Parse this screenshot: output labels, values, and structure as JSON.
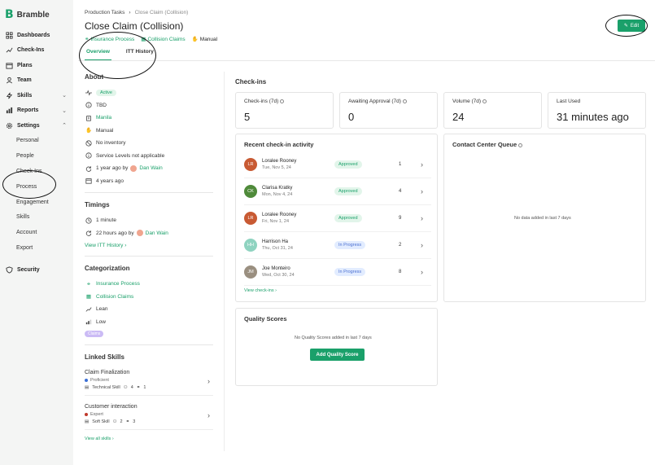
{
  "app": {
    "name": "Bramble"
  },
  "sidebar": {
    "items": [
      {
        "label": "Dashboards",
        "icon": "dashboard-icon"
      },
      {
        "label": "Check-Ins",
        "icon": "trend-icon"
      },
      {
        "label": "Plans",
        "icon": "calendar-icon"
      },
      {
        "label": "Team",
        "icon": "team-icon"
      },
      {
        "label": "Skills",
        "icon": "bolt-icon"
      },
      {
        "label": "Reports",
        "icon": "bar-chart-icon"
      },
      {
        "label": "Settings",
        "icon": "gear-icon"
      }
    ],
    "settings_children": [
      "Personal",
      "People",
      "Check-Ins",
      "Process",
      "Engagement",
      "Skills",
      "Account",
      "Export"
    ],
    "security": "Security"
  },
  "breadcrumb": {
    "parent": "Production Tasks",
    "current": "Close Claim (Collision)"
  },
  "page": {
    "title": "Close Claim (Collision)",
    "meta": {
      "process": "Insurance Process",
      "claims": "Collision Claims",
      "mode": "Manual"
    },
    "tabs": [
      "Overview",
      "ITT History"
    ],
    "edit_label": "Edit"
  },
  "about": {
    "title": "About",
    "status": "Active",
    "owner": "TBD",
    "location": "Manila",
    "mode": "Manual",
    "inventory": "No inventory",
    "service_levels": "Service Levels not applicable",
    "updated_prefix": "1 year ago by",
    "updated_by": "Dan Wain",
    "created": "4 years ago"
  },
  "timings": {
    "title": "Timings",
    "duration": "1 minute",
    "updated_prefix": "22 hours ago by",
    "updated_by": "Dan Wain",
    "history_link": "View ITT History"
  },
  "categorization": {
    "title": "Categorization",
    "process": "Insurance Process",
    "claims": "Collision Claims",
    "method": "Lean",
    "priority": "Low",
    "tag": "Claims"
  },
  "linked_skills": {
    "title": "Linked Skills",
    "skills": [
      {
        "name": "Claim Finalization",
        "level": "Proficient",
        "level_color": "#3b6fd6",
        "type": "Technical Skill",
        "people": "4",
        "links": "1"
      },
      {
        "name": "Customer interaction",
        "level": "Expert",
        "level_color": "#c0392b",
        "type": "Soft Skill",
        "people": "2",
        "links": "3"
      }
    ],
    "view_all": "View all skills"
  },
  "checkins": {
    "title": "Check-ins",
    "stats": [
      {
        "label": "Check-ins (7d)",
        "value": "5"
      },
      {
        "label": "Awaiting Approval (7d)",
        "value": "0"
      },
      {
        "label": "Volume (7d)",
        "value": "24"
      },
      {
        "label": "Last Used",
        "value": "31 minutes ago"
      }
    ],
    "recent_title": "Recent check-in activity",
    "recent": [
      {
        "initials": "LR",
        "name": "Loralee Rooney",
        "date": "Tue, Nov 5, 24",
        "status": "Approved",
        "count": "1",
        "color": "#c85a33"
      },
      {
        "initials": "CK",
        "name": "Clarisa Kratky",
        "date": "Mon, Nov 4, 24",
        "status": "Approved",
        "count": "4",
        "color": "#4f8a3a"
      },
      {
        "initials": "LR",
        "name": "Loralee Rooney",
        "date": "Fri, Nov 1, 24",
        "status": "Approved",
        "count": "9",
        "color": "#c85a33"
      },
      {
        "initials": "HH",
        "name": "Harrison Ha",
        "date": "Thu, Oct 31, 24",
        "status": "In Progress",
        "count": "2",
        "color": "#8fd3c0"
      },
      {
        "initials": "JM",
        "name": "Joe Monteiro",
        "date": "Wed, Oct 30, 24",
        "status": "In Progress",
        "count": "8",
        "color": "#9a8f80"
      }
    ],
    "view_link": "View check-ins",
    "queue_title": "Contact Center Queue",
    "queue_empty": "No data added in last 7 days"
  },
  "quality": {
    "title": "Quality Scores",
    "empty": "No Quality Scores added in last 7 days",
    "button": "Add Quality Score"
  }
}
